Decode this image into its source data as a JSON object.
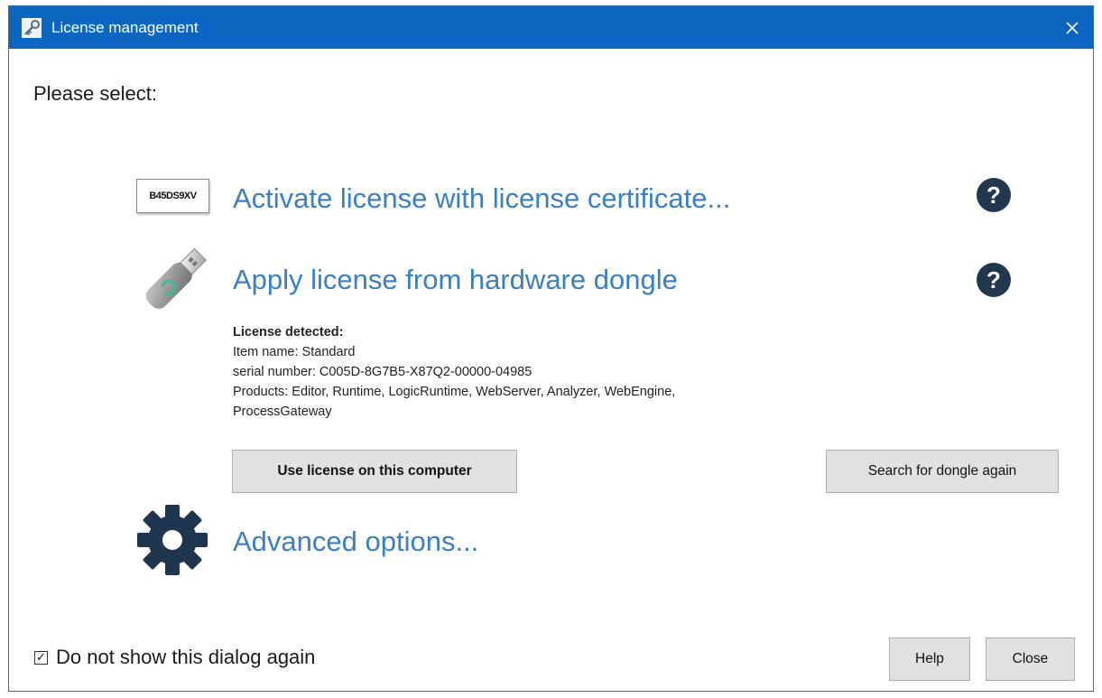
{
  "window": {
    "title": "License management",
    "close_glyph": "✕",
    "icon": "key-icon"
  },
  "prompt": "Please select:",
  "options": {
    "certificate": {
      "label": "Activate license with license certificate...",
      "icon_text": "B45DS9XV",
      "help_glyph": "?"
    },
    "dongle": {
      "label": "Apply license from hardware dongle",
      "icon": "usb-dongle-icon",
      "help_glyph": "?"
    },
    "advanced": {
      "label": "Advanced options...",
      "icon": "gear-icon"
    }
  },
  "license": {
    "header": "License detected:",
    "item_name": "Item name: Standard",
    "serial": "serial number: C005D-8G7B5-X87Q2-00000-04985",
    "products_line1": "Products: Editor, Runtime, LogicRuntime, WebServer, Analyzer, WebEngine,",
    "products_line2": "ProcessGateway"
  },
  "buttons": {
    "use_license": "Use license on this computer",
    "search_dongle": "Search for dongle again",
    "help": "Help",
    "close": "Close"
  },
  "footer": {
    "dont_show_label": "Do not show this dialog again",
    "dont_show_checked": true,
    "check_glyph": "✓"
  },
  "colors": {
    "titlebar": "#0d66c2",
    "link": "#3a7fc1",
    "help_badge": "#22384f",
    "gear": "#1f3650"
  }
}
